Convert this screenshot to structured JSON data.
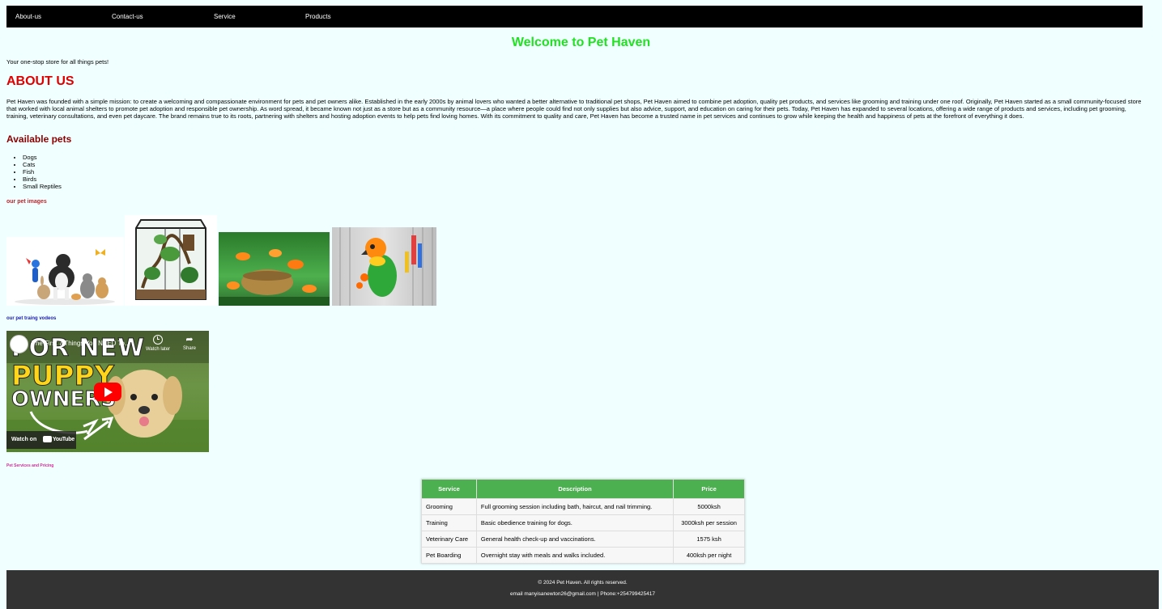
{
  "nav": {
    "items": [
      "About-us",
      "Contact-us",
      "Service",
      "Products"
    ]
  },
  "header": {
    "title": "Welcome to Pet Haven",
    "tagline": "Your one-stop store for all things pets!"
  },
  "about": {
    "heading": "ABOUT US",
    "body": "Pet Haven was founded with a simple mission: to create a welcoming and compassionate environment for pets and pet owners alike. Established in the early 2000s by animal lovers who wanted a better alternative to traditional pet shops, Pet Haven aimed to combine pet adoption, quality pet products, and services like grooming and training under one roof. Originally, Pet Haven started as a small community-focused store that worked with local animal shelters to promote pet adoption and responsible pet ownership. As word spread, it became known not just as a store but as a community resource—a place where people could find not only supplies but also advice, support, and education on caring for their pets. Today, Pet Haven has expanded to several locations, offering a wide range of products and services, including pet grooming, training, veterinary consultations, and even pet daycare. The brand remains true to its roots, partnering with shelters and hosting adoption events to help pets find loving homes. With its commitment to quality and care, Pet Haven has become a trusted name in pet services and continues to grow while keeping the health and happiness of pets at the forefront of everything it does."
  },
  "pets": {
    "heading": "Available pets",
    "items": [
      "Dogs",
      "Cats",
      "Fish",
      "Birds",
      "Small Reptiles"
    ]
  },
  "images": {
    "heading": "our pet images"
  },
  "videos": {
    "heading": "our pet traing vodeos",
    "title": "The First 7 Things You NEED To...",
    "thumb_line1": "FOR NEW",
    "thumb_line2": "PUPPY",
    "thumb_line3": "OWNERS",
    "watch_later": "Watch later",
    "share": "Share",
    "watch_on": "Watch on",
    "youtube": "YouTube"
  },
  "services": {
    "heading": "Pet Services and Pricing",
    "columns": [
      "Service",
      "Description",
      "Price"
    ],
    "rows": [
      [
        "Grooming",
        "Full grooming session including bath, haircut, and nail trimming.",
        "5000ksh"
      ],
      [
        "Training",
        "Basic obedience training for dogs.",
        "3000ksh per session"
      ],
      [
        "Veterinary Care",
        "General health check-up and vaccinations.",
        "1575 ksh"
      ],
      [
        "Pet Boarding",
        "Overnight stay with meals and walks included.",
        "400ksh per night"
      ]
    ]
  },
  "footer": {
    "copyright": "© 2024 Pet Haven. All rights reserved.",
    "contact": "email manyisanewton26@gmail.com | Phone:+254799425417"
  },
  "colors": {
    "nav_bg": "#000000",
    "welcome": "#22e022",
    "about_heading": "#e00000",
    "pets_heading": "#8b0000",
    "table_header": "#4caf50",
    "footer_bg": "#333333",
    "page_bg": "#f0ffff"
  }
}
